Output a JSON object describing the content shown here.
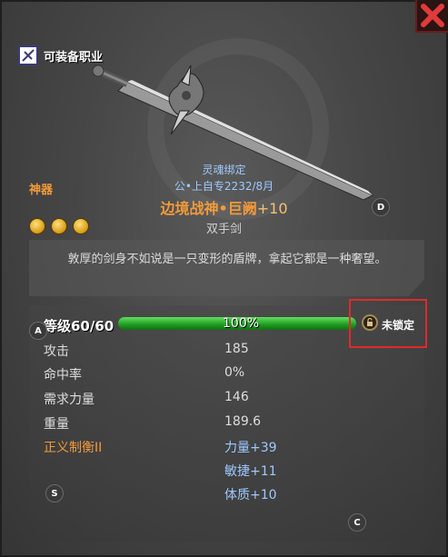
{
  "header": {
    "class_label": "可装备职业"
  },
  "item": {
    "grade": "神器",
    "bind": "灵魂绑定",
    "owner": "公•上自专2232/8月",
    "name": "边境战神•巨阙",
    "enhance": "+10",
    "type": "双手剑",
    "stars": 3,
    "description": "敦厚的剑身不如说是一只变形的盾牌，拿起它都是一种奢望。"
  },
  "level": {
    "label": "等级60/60",
    "progress_percent": 100,
    "progress_text": "100%"
  },
  "lock": {
    "status": "未锁定"
  },
  "stats": [
    {
      "label": "攻击",
      "value": "185"
    },
    {
      "label": "命中率",
      "value": "0%"
    },
    {
      "label": "需求力量",
      "value": "146"
    },
    {
      "label": "重量",
      "value": "189.6"
    }
  ],
  "set_bonus": {
    "name": "正义制衡II",
    "bonuses": [
      "力量+39",
      "敏捷+11",
      "体质+10"
    ]
  },
  "badges": {
    "a": "A",
    "d": "D",
    "s": "S",
    "c": "C"
  },
  "colors": {
    "orange": "#f39a3a",
    "blue": "#9ec9ff",
    "progress_green": "#2fbf2f",
    "highlight_red": "#e02a2a"
  }
}
